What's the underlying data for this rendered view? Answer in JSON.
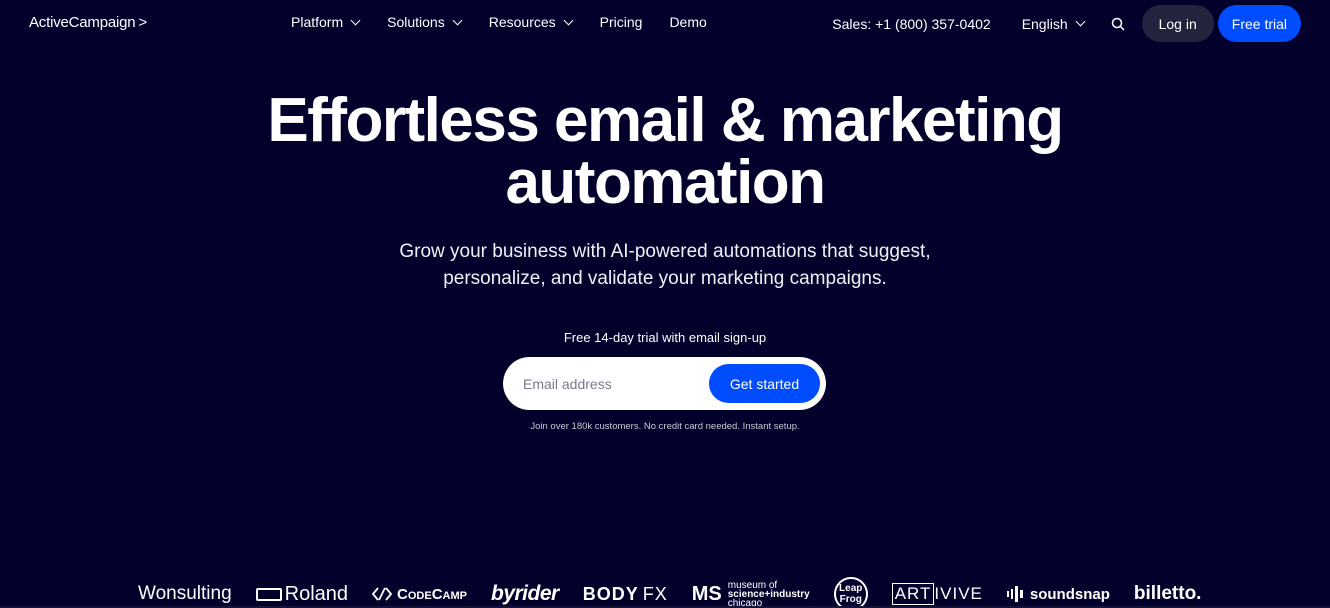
{
  "header": {
    "logo": "ActiveCampaign",
    "logo_mark": ">",
    "nav": [
      {
        "label": "Platform",
        "has_dropdown": true
      },
      {
        "label": "Solutions",
        "has_dropdown": true
      },
      {
        "label": "Resources",
        "has_dropdown": true
      },
      {
        "label": "Pricing",
        "has_dropdown": false
      },
      {
        "label": "Demo",
        "has_dropdown": false
      }
    ],
    "sales": "Sales: +1 (800) 357-0402",
    "language": "English",
    "search_icon": "search-icon",
    "login_label": "Log in",
    "trial_label": "Free trial"
  },
  "hero": {
    "title_line1": "Effortless email & marketing",
    "title_line2": "automation",
    "subtitle_line1": "Grow your business with AI-powered automations that suggest,",
    "subtitle_line2": "personalize, and validate your marketing campaigns.",
    "trial_note": "Free 14-day trial with email sign-up",
    "email_placeholder": "Email address",
    "email_value": "",
    "cta_label": "Get started",
    "fine_print": "Join over 180k customers. No credit card needed. Instant setup."
  },
  "colors": {
    "background": "#03002b",
    "accent": "#004cff",
    "login_bg": "#23233d"
  },
  "customer_logos": {
    "wonsulting": "Wonsulting",
    "roland": "Roland",
    "codecamp": "CodeCamp",
    "byrider": "byrider",
    "bodyfx_body": "BODY",
    "bodyfx_fx": "FX",
    "msi_line1": "museum of",
    "msi_line2": "science+industry",
    "msi_line3": "chicago",
    "leapfrog_line1": "Leap",
    "leapfrog_line2": "Frog",
    "artivive_box": "ART",
    "artivive_rest": "IVIVE",
    "soundsnap": "soundsnap",
    "billetto": "billetto."
  }
}
